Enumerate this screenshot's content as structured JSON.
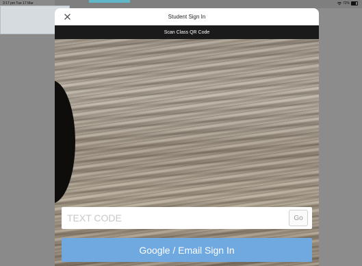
{
  "status_bar": {
    "time": "3:17 pm  Tue 17 Mar",
    "battery": "72%",
    "battery_level": 0.72,
    "wifi_icon": "wifi-icon",
    "battery_icon": "battery-icon"
  },
  "modal": {
    "title": "Student Sign In",
    "close_icon": "close-icon",
    "scan_label": "Scan Class QR Code",
    "text_code": {
      "placeholder": "TEXT CODE",
      "value": ""
    },
    "go_label": "Go",
    "signin_label": "Google / Email Sign In"
  },
  "colors": {
    "signin_button": "#70a8e0",
    "scan_bar": "#1a1a1a",
    "overlay": "#7f7f7f"
  }
}
